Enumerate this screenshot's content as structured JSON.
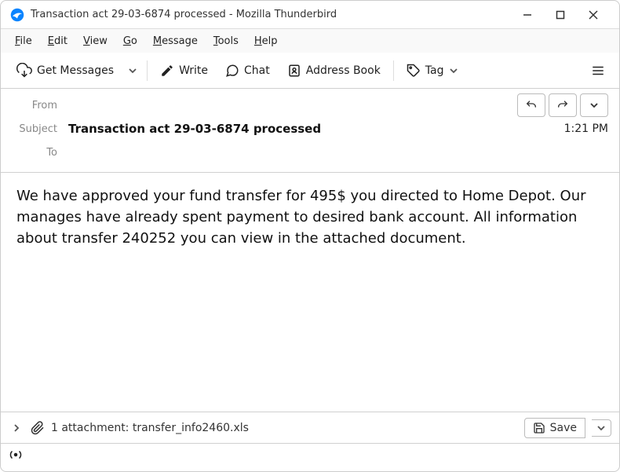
{
  "window": {
    "title": "Transaction act 29-03-6874 processed - Mozilla Thunderbird"
  },
  "menu": {
    "file": "File",
    "edit": "Edit",
    "view": "View",
    "go": "Go",
    "message": "Message",
    "tools": "Tools",
    "help": "Help"
  },
  "toolbar": {
    "get_messages": "Get Messages",
    "write": "Write",
    "chat": "Chat",
    "address_book": "Address Book",
    "tag": "Tag"
  },
  "headers": {
    "from_label": "From",
    "from_value": "",
    "subject_label": "Subject",
    "subject_value": "Transaction act 29-03-6874 processed",
    "to_label": "To",
    "to_value": "",
    "time": "1:21 PM"
  },
  "body": "We have approved your fund transfer for 495$ you directed to Home Depot. Our manages have already spent payment to desired bank account. All information about transfer 240252 you can view in the attached document.",
  "attachment": {
    "summary": "1 attachment: transfer_info2460.xls",
    "save_label": "Save"
  }
}
